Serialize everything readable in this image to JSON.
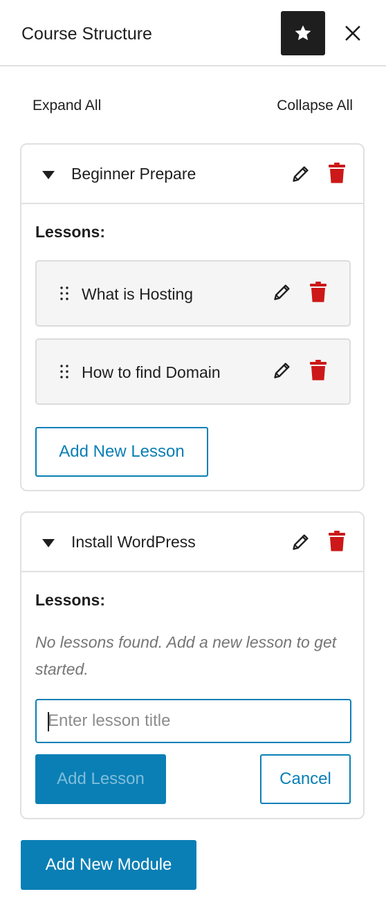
{
  "header": {
    "title": "Course Structure",
    "star_icon": "star-icon",
    "close_icon": "close-icon"
  },
  "controls": {
    "expand_all": "Expand All",
    "collapse_all": "Collapse All"
  },
  "modules": [
    {
      "title": "Beginner Prepare",
      "lessons_label": "Lessons:",
      "lessons": [
        {
          "title": "What is Hosting"
        },
        {
          "title": "How to find Domain"
        }
      ],
      "add_lesson_label": "Add New Lesson"
    },
    {
      "title": "Install WordPress",
      "lessons_label": "Lessons:",
      "empty_message": "No lessons found. Add a new lesson to get started.",
      "input_placeholder": "Enter lesson title",
      "add_button_label": "Add Lesson",
      "cancel_button_label": "Cancel"
    }
  ],
  "add_module_label": "Add New Module",
  "colors": {
    "accent": "#0a7fb5",
    "danger": "#cc1818",
    "dark": "#1e1e1e",
    "border": "#e0e0e0"
  }
}
